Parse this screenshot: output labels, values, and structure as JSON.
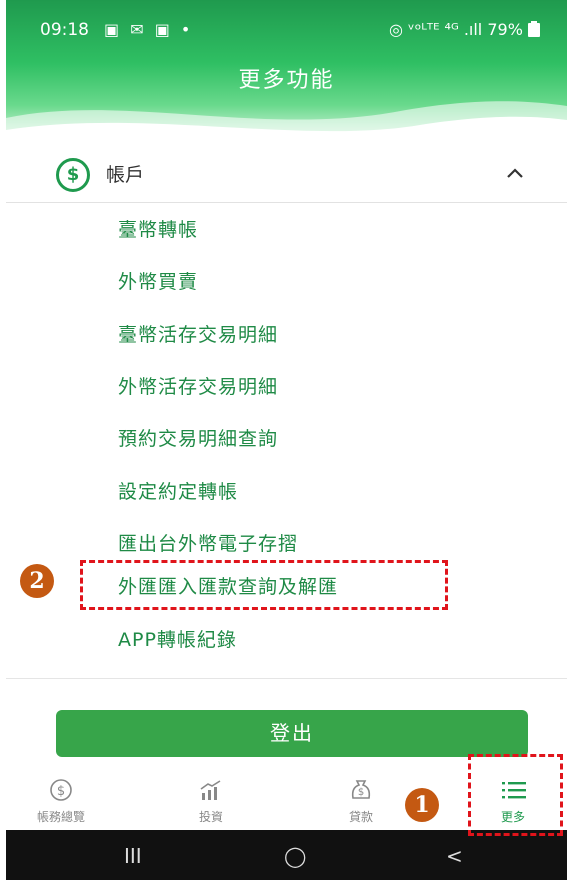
{
  "status_bar": {
    "time": "09:18",
    "left_icons": "▣ ✉ ▣ •",
    "right_text": "◎ ᵛᵒᴸᵀᴱ ⁴ᴳ .ıll 79%",
    "battery_icon": "battery-icon"
  },
  "header": {
    "title": "更多功能"
  },
  "account": {
    "icon_glyph": "$",
    "label": "帳戶"
  },
  "menu": {
    "items": [
      {
        "label": "臺幣轉帳"
      },
      {
        "label": "外幣買賣"
      },
      {
        "label": "臺幣活存交易明細"
      },
      {
        "label": "外幣活存交易明細"
      },
      {
        "label": "預約交易明細查詢"
      },
      {
        "label": "設定約定轉帳"
      },
      {
        "label": "匯出台外幣電子存摺"
      },
      {
        "label": "外匯匯入匯款查詢及解匯"
      },
      {
        "label": "APP轉帳紀錄"
      }
    ]
  },
  "logout": {
    "label": "登出"
  },
  "bottom_nav": {
    "items": [
      {
        "label": "帳務總覽",
        "icon": "dollar-icon"
      },
      {
        "label": "投資",
        "icon": "chart-icon"
      },
      {
        "label": "貸款",
        "icon": "money-bag-icon"
      },
      {
        "label": "更多",
        "icon": "menu-icon",
        "active": true
      }
    ]
  },
  "system_nav": {
    "recents": "III",
    "home": "◯",
    "back": "<"
  },
  "annotations": {
    "marker_1": "1",
    "marker_2": "2"
  },
  "colors": {
    "brand_green": "#1f9a4e",
    "link_green": "#1f8a46",
    "button_green": "#37a54a",
    "annotation_red": "#e0141b",
    "badge_orange": "#c45912"
  }
}
